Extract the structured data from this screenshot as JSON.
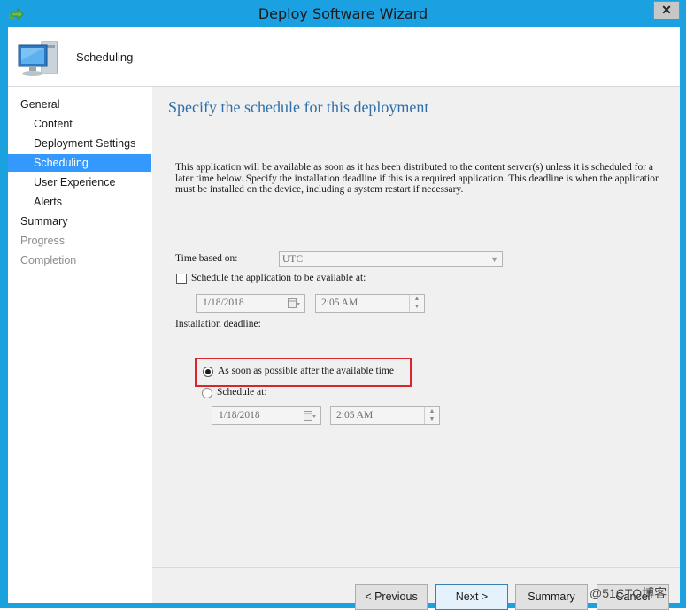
{
  "window": {
    "title": "Deploy Software Wizard",
    "close_label": "✕"
  },
  "header": {
    "title": "Scheduling"
  },
  "nav": {
    "general": "General",
    "content": "Content",
    "deployment_settings": "Deployment Settings",
    "scheduling": "Scheduling",
    "user_experience": "User Experience",
    "alerts": "Alerts",
    "summary": "Summary",
    "progress": "Progress",
    "completion": "Completion"
  },
  "main": {
    "heading": "Specify the schedule for this deployment",
    "description": "This application will be available as soon as it has been distributed to the content server(s) unless it is scheduled for a later time below. Specify the installation deadline if this is a required application. This deadline is when the application must be installed on the device, including a system restart if necessary.",
    "time_based_label": "Time based on:",
    "time_based_value": "UTC",
    "schedule_available_label": "Schedule the application to be available at:",
    "available_date": "1/18/2018",
    "available_time": "2:05 AM",
    "deadline_label": "Installation deadline:",
    "asap_label": "As soon as possible after the available time",
    "schedule_at_label": "Schedule at:",
    "deadline_date": "1/18/2018",
    "deadline_time": "2:05 AM",
    "asap_selected": true,
    "schedule_available_checked": false
  },
  "buttons": {
    "previous": "< Previous",
    "next": "Next >",
    "summary": "Summary",
    "cancel": "Cancel"
  },
  "watermark": "@51CTO博客",
  "colors": {
    "selection": "#3399ff",
    "title_bar": "#1ba1e2",
    "highlight_box": "#d9262c",
    "heading": "#2f6fa8"
  }
}
